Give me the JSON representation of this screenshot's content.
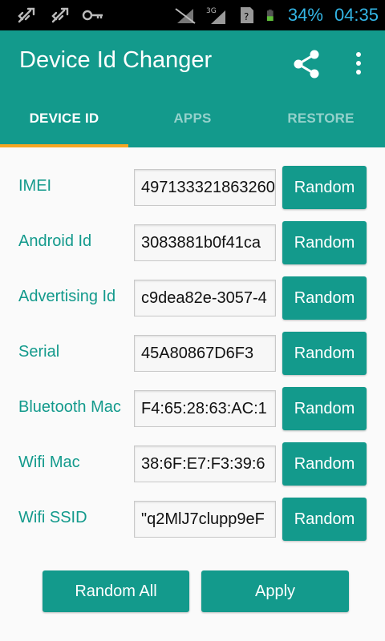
{
  "status_bar": {
    "icons": [
      "usb-icon",
      "usb-icon",
      "key-icon",
      "no-signal-icon",
      "3g-signal-icon",
      "sim-icon",
      "battery-icon"
    ],
    "network_type": "3G",
    "battery": "34%",
    "time": "04:35"
  },
  "app_bar": {
    "title": "Device Id Changer",
    "actions": [
      "share-icon",
      "overflow-menu-icon"
    ]
  },
  "tabs": [
    {
      "label": "DEVICE ID",
      "active": true
    },
    {
      "label": "APPS",
      "active": false
    },
    {
      "label": "RESTORE",
      "active": false
    }
  ],
  "fields": [
    {
      "label": "IMEI",
      "value": "497133321863260"
    },
    {
      "label": "Android Id",
      "value": "3083881b0f41ca"
    },
    {
      "label": "Advertising Id",
      "value": "c9dea82e-3057-4"
    },
    {
      "label": "Serial",
      "value": "45A80867D6F3"
    },
    {
      "label": "Bluetooth Mac",
      "value": "F4:65:28:63:AC:1"
    },
    {
      "label": "Wifi Mac",
      "value": "38:6F:E7:F3:39:6"
    },
    {
      "label": "Wifi SSID",
      "value": "\"q2MlJ7clupp9eF"
    }
  ],
  "random_label": "Random",
  "buttons": {
    "random_all": "Random All",
    "apply": "Apply"
  },
  "colors": {
    "primary": "#139a8c",
    "tab_indicator": "#f5a623",
    "status_icons": "#33b5e5"
  }
}
